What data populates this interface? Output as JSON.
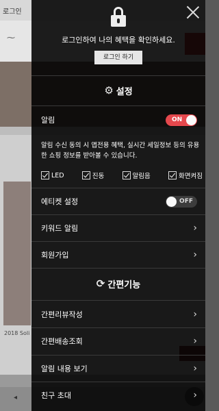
{
  "background": {
    "tab_label": "로그인",
    "product_label": "2018 Soli",
    "bottom_arrow": "◂"
  },
  "drawer": {
    "login_message": "로그인하여 나의 혜택을 확인하세요.",
    "login_button": "로그인 하기",
    "settings_title": "설정",
    "alarm": {
      "label": "알림",
      "toggle": "ON"
    },
    "alarm_description": "알림 수신 동의 시 앱전용 혜택, 실시간 세일정보 등의 유용한 쇼핑 정보를 받아볼 수 있습니다.",
    "checkboxes": [
      {
        "label": "LED",
        "checked": true
      },
      {
        "label": "진동",
        "checked": true
      },
      {
        "label": "알림음",
        "checked": true
      },
      {
        "label": "화면켜짐",
        "checked": true
      }
    ],
    "etiquette": {
      "label": "에티켓 설정",
      "toggle": "OFF"
    },
    "keyword_alarm": "키워드 알림",
    "signup": "회원가입",
    "quick_title": "간편기능",
    "quick_items": [
      "간편리뷰작성",
      "간편배송조회",
      "알림 내용 보기",
      "친구 초대"
    ]
  },
  "colors": {
    "toggle_on": "#e5484d",
    "toggle_off": "#3c3c3c",
    "drawer_bg": "rgba(0,0,0,0.88)"
  },
  "icons": {
    "close": "close-icon",
    "lock": "lock-icon",
    "settings": "gear-icon",
    "quick": "refresh-icon",
    "chevron": "chevron-right-icon"
  }
}
